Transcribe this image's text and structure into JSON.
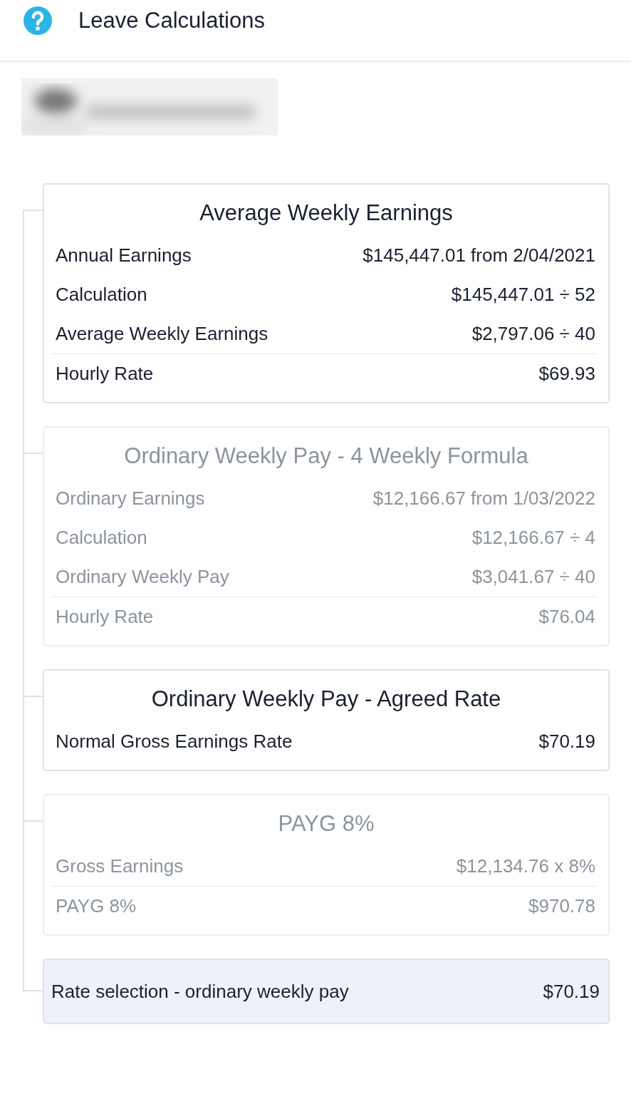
{
  "header": {
    "title": "Leave Calculations"
  },
  "cards": [
    {
      "title": "Average Weekly Earnings",
      "active": true,
      "rows": [
        {
          "label": "Annual Earnings",
          "value": "$145,447.01 from 2/04/2021"
        },
        {
          "label": "Calculation",
          "value": "$145,447.01 ÷ 52"
        },
        {
          "label": "Average Weekly Earnings",
          "value": "$2,797.06 ÷ 40"
        },
        {
          "label": "Hourly Rate",
          "value": "$69.93"
        }
      ]
    },
    {
      "title": "Ordinary Weekly Pay - 4 Weekly Formula",
      "active": false,
      "rows": [
        {
          "label": "Ordinary Earnings",
          "value": "$12,166.67 from 1/03/2022"
        },
        {
          "label": "Calculation",
          "value": "$12,166.67 ÷ 4"
        },
        {
          "label": "Ordinary Weekly Pay",
          "value": "$3,041.67 ÷ 40"
        },
        {
          "label": "Hourly Rate",
          "value": "$76.04"
        }
      ]
    },
    {
      "title": "Ordinary Weekly Pay - Agreed Rate",
      "active": true,
      "rows": [
        {
          "label": "Normal Gross Earnings Rate",
          "value": "$70.19"
        }
      ]
    },
    {
      "title": "PAYG 8%",
      "active": false,
      "rows": [
        {
          "label": "Gross Earnings",
          "value": "$12,134.76 x 8%"
        },
        {
          "label": "PAYG 8%",
          "value": "$970.78"
        }
      ]
    }
  ],
  "selection": {
    "label": "Rate selection - ordinary weekly pay",
    "value": "$70.19"
  }
}
